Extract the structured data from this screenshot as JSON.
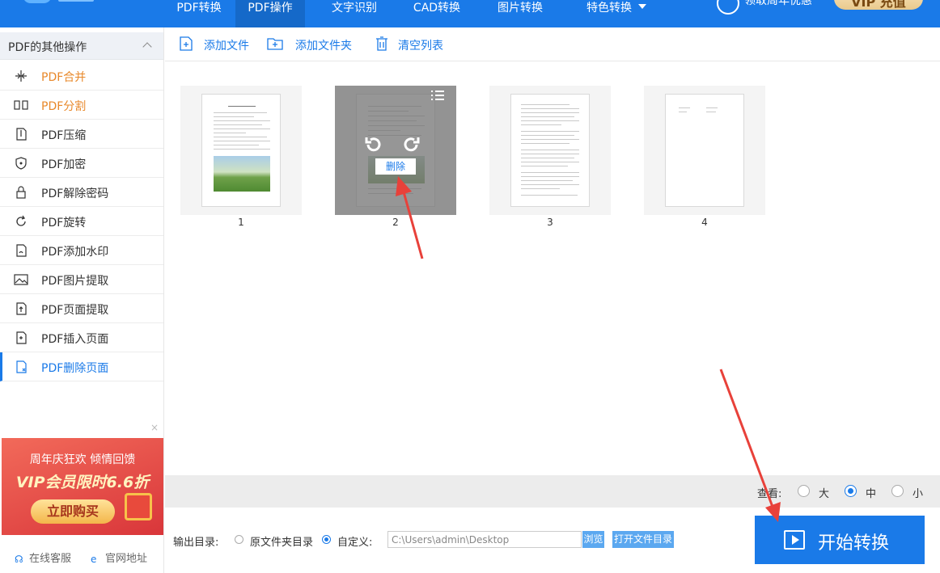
{
  "topnav": {
    "tabs": [
      {
        "label": "PDF转换"
      },
      {
        "label": "PDF操作"
      },
      {
        "label": "文字识别"
      },
      {
        "label": "CAD转换"
      },
      {
        "label": "图片转换"
      },
      {
        "label": "特色转换"
      }
    ],
    "active_tab": "PDF操作",
    "promo_text": "领取周年优惠",
    "vip_label": "VIP 充值"
  },
  "sidebar": {
    "section_title": "PDF的其他操作",
    "items": [
      {
        "label": "PDF合并",
        "icon": "merge-icon"
      },
      {
        "label": "PDF分割",
        "icon": "split-icon"
      },
      {
        "label": "PDF压缩",
        "icon": "compress-icon"
      },
      {
        "label": "PDF加密",
        "icon": "shield-icon"
      },
      {
        "label": "PDF解除密码",
        "icon": "lock-icon"
      },
      {
        "label": "PDF旋转",
        "icon": "rotate-icon"
      },
      {
        "label": "PDF添加水印",
        "icon": "watermark-icon"
      },
      {
        "label": "PDF图片提取",
        "icon": "image-icon"
      },
      {
        "label": "PDF页面提取",
        "icon": "page-extract-icon"
      },
      {
        "label": "PDF插入页面",
        "icon": "page-insert-icon"
      },
      {
        "label": "PDF删除页面",
        "icon": "page-delete-icon"
      }
    ],
    "selected_item": "PDF删除页面",
    "ad": {
      "line1": "周年庆狂欢 倾情回馈",
      "line2": "VIP会员限时6.6折",
      "button": "立即购买",
      "close": "×"
    },
    "footer": {
      "support": "在线客服",
      "website": "官网地址"
    }
  },
  "toolbar": {
    "add_file": "添加文件",
    "add_folder": "添加文件夹",
    "clear_list": "清空列表"
  },
  "pages": [
    {
      "number": "1"
    },
    {
      "number": "2",
      "hovered": true
    },
    {
      "number": "3"
    },
    {
      "number": "4"
    }
  ],
  "page_actions": {
    "delete": "删除"
  },
  "view": {
    "label": "查看:",
    "options": [
      "大",
      "中",
      "小"
    ],
    "selected": "中"
  },
  "output": {
    "label": "输出目录:",
    "option_original": "原文件夹目录",
    "option_custom": "自定义:",
    "selected": "自定义:",
    "path": "C:\\Users\\admin\\Desktop",
    "browse": "浏览",
    "open_folder": "打开文件目录"
  },
  "start_button": "开始转换",
  "colors": {
    "primary": "#1a7ae8",
    "accent_orange": "#e8882a",
    "annotation_red": "#e8413a"
  }
}
